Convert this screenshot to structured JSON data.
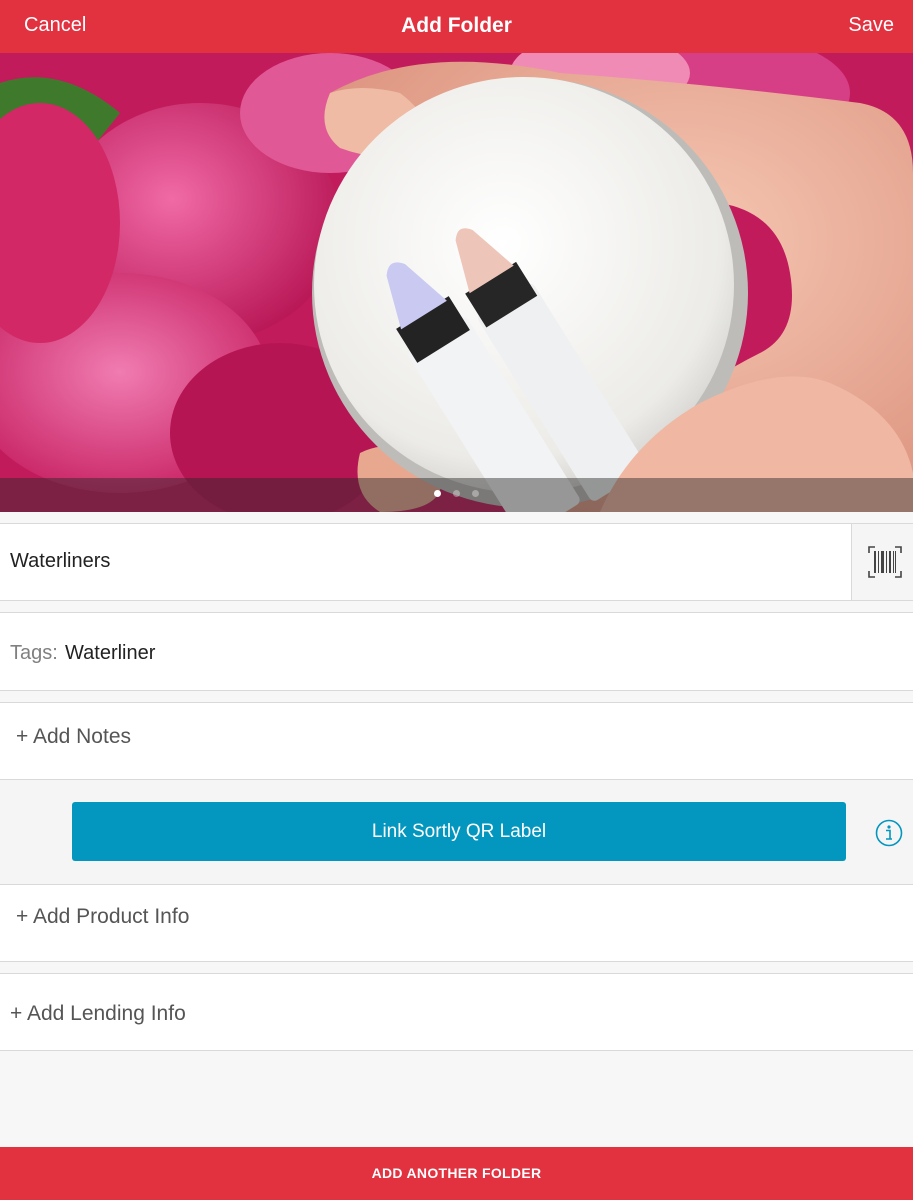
{
  "header": {
    "cancel_label": "Cancel",
    "title": "Add Folder",
    "save_label": "Save"
  },
  "photo": {
    "page_count": 3,
    "active_page": 1
  },
  "folder": {
    "name": "Waterliners"
  },
  "tags": {
    "label": "Tags:",
    "value": "Waterliner"
  },
  "notes": {
    "label": "+ Add Notes"
  },
  "qr": {
    "button_label": "Link Sortly QR Label"
  },
  "product": {
    "label": "+ Add Product Info"
  },
  "lending": {
    "label": "+ Add Lending Info"
  },
  "footer": {
    "button_label": "ADD ANOTHER FOLDER"
  },
  "colors": {
    "brand_red": "#e2313f",
    "accent_blue": "#0396bf"
  },
  "icons": {
    "barcode": "barcode-scan-icon",
    "info": "info-icon"
  }
}
